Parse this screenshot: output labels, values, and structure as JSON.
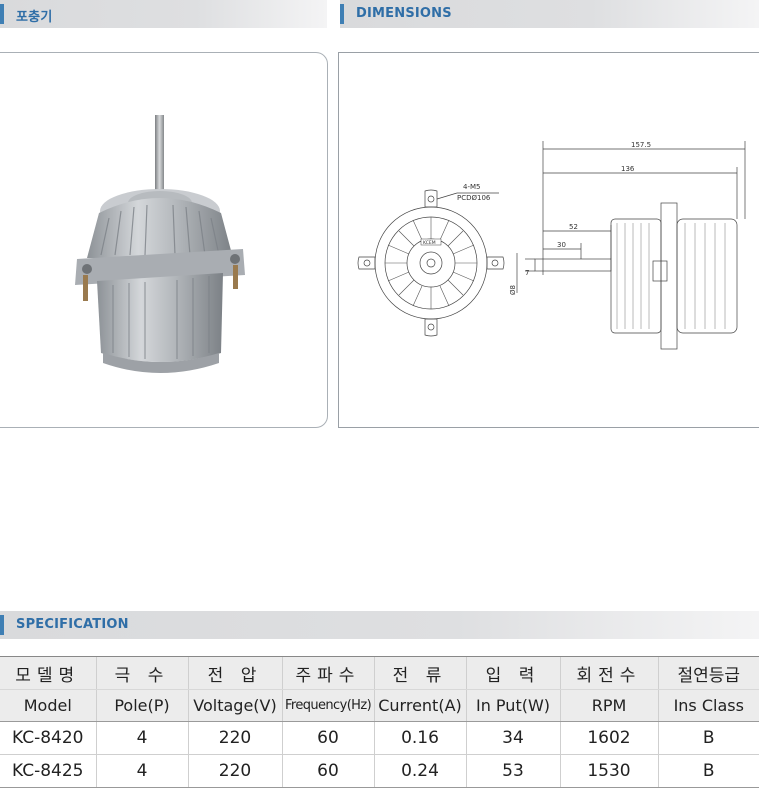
{
  "product_header": {
    "title": "포충기"
  },
  "dimensions_header": {
    "title": "DIMENSIONS"
  },
  "specification_header": {
    "title": "SPECIFICATION"
  },
  "drawing": {
    "hole_label": "4-M5",
    "pcd_label": "PCDØ106",
    "overall_length": "157.5",
    "body_length": "136",
    "shaft_to_flange": "52",
    "shaft_length": "30",
    "shaft_flat": "7",
    "shaft_diameter": "Ø8",
    "badge": "KCEM"
  },
  "spec_table": {
    "headers_kr": [
      "모델명",
      "극 수",
      "전 압",
      "주파수",
      "전 류",
      "입 력",
      "회전수",
      "절연등급"
    ],
    "headers_en": [
      "Model",
      "Pole(P)",
      "Voltage(V)",
      "Frequency(Hz)",
      "Current(A)",
      "In Put(W)",
      "RPM",
      "Ins Class"
    ],
    "rows": [
      [
        "KC-8420",
        "4",
        "220",
        "60",
        "0.16",
        "34",
        "1602",
        "B"
      ],
      [
        "KC-8425",
        "4",
        "220",
        "60",
        "0.24",
        "53",
        "1530",
        "B"
      ]
    ]
  },
  "colors": {
    "accent": "#3f7fb4",
    "header_text": "#2f6ea7",
    "header_bg": "#dcdddf"
  }
}
